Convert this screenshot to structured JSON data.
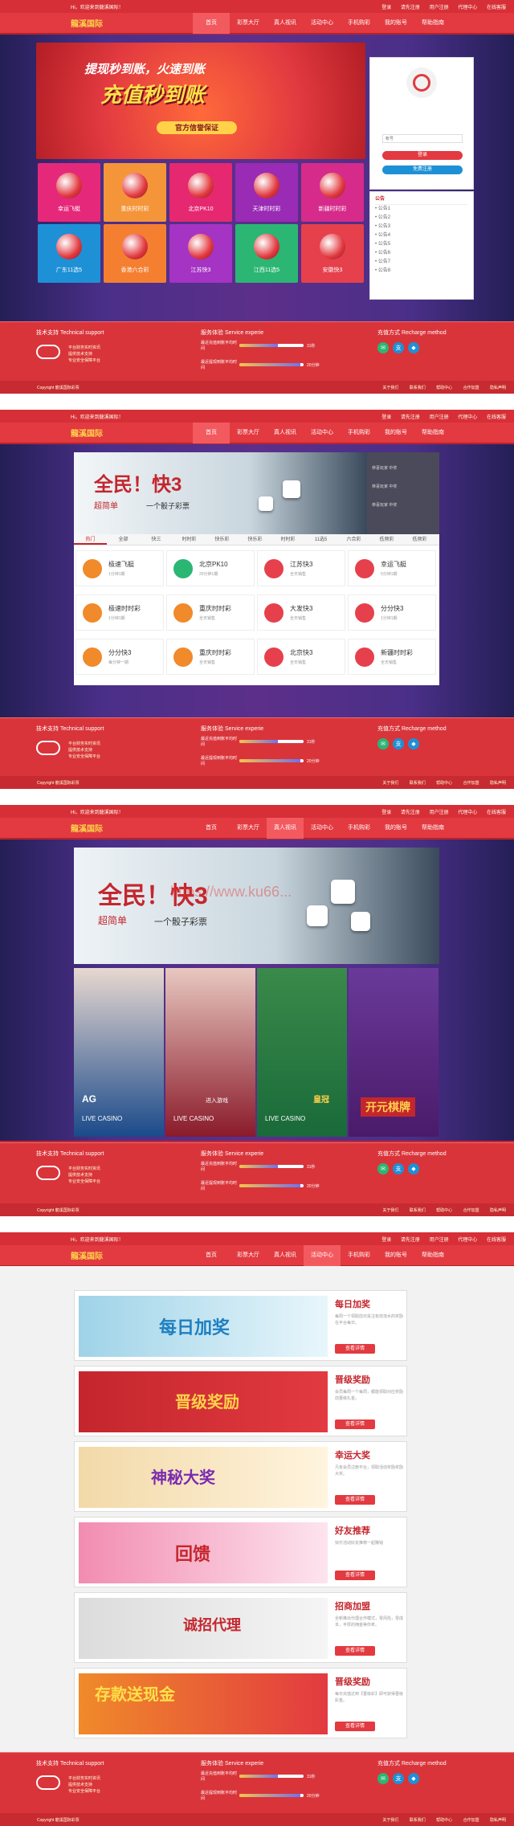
{
  "site": {
    "logo": "龍溪国际",
    "top_left": "Hi，欢迎来到龍溪国际！",
    "top_links": [
      "登录",
      "请先注册",
      "用户注册",
      "代理中心",
      "在线客服"
    ]
  },
  "nav": {
    "items": [
      "首页",
      "彩票大厅",
      "真人视讯",
      "活动中心",
      "手机购彩",
      "我的账号",
      "帮助指南"
    ],
    "active_per_screen": [
      0,
      0,
      2,
      3
    ]
  },
  "screen1": {
    "hero_line1": "提现秒到账，火速到账",
    "hero_line2": "充值秒到账",
    "hero_btn": "官方信誉保证",
    "login": {
      "username_placeholder": "帐号",
      "login_btn": "登录",
      "register_btn": "免费注册"
    },
    "notice_title": "公告",
    "notice_items": [
      "• 公告1",
      "• 公告2",
      "• 公告3",
      "• 公告4",
      "• 公告5",
      "• 公告6",
      "• 公告7",
      "• 公告8"
    ],
    "tiles": [
      {
        "name": "幸运飞艇",
        "color": "#e6287a"
      },
      {
        "name": "重庆时时彩",
        "color": "#f5953a"
      },
      {
        "name": "北京PK10",
        "color": "#e62870"
      },
      {
        "name": "天津时时彩",
        "color": "#9a2bb5"
      },
      {
        "name": "新疆时时彩",
        "color": "#d62b8a"
      },
      {
        "name": "广东11选5",
        "color": "#1e90d6"
      },
      {
        "name": "香港六合彩",
        "color": "#f57f31"
      },
      {
        "name": "江苏快3",
        "color": "#a533c3"
      },
      {
        "name": "江西11选5",
        "color": "#2cb673"
      },
      {
        "name": "安徽快3",
        "color": "#e6404c"
      }
    ]
  },
  "screen2": {
    "banner_title": "全民！快3",
    "banner_sub": "超简单",
    "banner_sub2": "一个骰子彩票",
    "side_users": [
      "恭喜玩家 中奖",
      "恭喜玩家 中奖",
      "恭喜玩家 中奖"
    ],
    "tabs": [
      "热门",
      "全部",
      "快三",
      "时时彩",
      "快乐彩",
      "快乐彩",
      "时时彩",
      "11选5",
      "六合彩",
      "低频彩",
      "低频彩"
    ],
    "cards": [
      {
        "name": "极速飞艇",
        "sub": "1分钟1期",
        "color": "#f08a2a"
      },
      {
        "name": "北京PK10",
        "sub": "20分钟1期",
        "color": "#2bb673"
      },
      {
        "name": "江苏快3",
        "sub": "全天销售",
        "color": "#e6404c"
      },
      {
        "name": "幸运飞艇",
        "sub": "5分钟1期",
        "color": "#e6404c"
      },
      {
        "name": "极速时时彩",
        "sub": "1分钟1期",
        "color": "#f08a2a"
      },
      {
        "name": "重庆时时彩",
        "sub": "全天销售",
        "color": "#f08a2a"
      },
      {
        "name": "大发快3",
        "sub": "全天销售",
        "color": "#e6404c"
      },
      {
        "name": "分分快3",
        "sub": "1分钟1期",
        "color": "#e6404c"
      },
      {
        "name": "分分快3",
        "sub": "每分钟一期",
        "color": "#f08a2a"
      },
      {
        "name": "重庆时时彩",
        "sub": "全天销售",
        "color": "#f08a2a"
      },
      {
        "name": "北京快3",
        "sub": "全天销售",
        "color": "#e6404c"
      },
      {
        "name": "新疆时时彩",
        "sub": "全天销售",
        "color": "#e6404c"
      }
    ]
  },
  "screen3": {
    "banner_title": "全民！快3",
    "banner_sub": "超简单",
    "banner_sub2": "一个骰子彩票",
    "watermark": "https://www.ku66...",
    "casinos": [
      {
        "label": "LIVE CASINO",
        "brand": "AG",
        "color": "#1a4a8a"
      },
      {
        "label": "LIVE CASINO",
        "brand": "进入游戏",
        "color": "#8a1a2a"
      },
      {
        "label": "LIVE CASINO",
        "brand": "皇冠",
        "color": "#1a6a3a"
      },
      {
        "label": "开元棋牌",
        "brand": "",
        "color": "#4a1a6a"
      }
    ]
  },
  "screen4": {
    "promos": [
      {
        "title": "每日加奖",
        "banner": "每日加奖",
        "desc": "每周一个领取前日投注有效流水的奖励在平台每日。",
        "btn": "查看详情",
        "bg1": "#9fd3e8",
        "bg2": "#e8f6fb"
      },
      {
        "title": "晋级奖励",
        "banner": "晋级奖励",
        "desc": "会员每周一个每周，都能领取对应奖励前晋级礼金。",
        "btn": "查看详情",
        "bg1": "#c4262d",
        "bg2": "#e23a40"
      },
      {
        "title": "幸运大奖",
        "banner": "神秘大奖",
        "desc": "凡有会员注册平台，领取活动奖励奖励大奖。",
        "btn": "查看详情",
        "bg1": "#f2d9a8",
        "bg2": "#fff4de"
      },
      {
        "title": "好友推荐",
        "banner": "回馈",
        "desc": "快乐活动好友推荐一起赚钱",
        "btn": "查看详情",
        "bg1": "#f28cb0",
        "bg2": "#fde4ee"
      },
      {
        "title": "招商加盟",
        "banner": "诚招代理",
        "desc": "全新推出代理合作模式，零风险，零成本，丰厚的佣金等你拿。",
        "btn": "查看详情",
        "bg1": "#dcdcdc",
        "bg2": "#f5f5f5"
      },
      {
        "title": "晋级奖励",
        "banner": "存款送现金",
        "desc": "每日充值达到【晋级彩】即可获得晋级彩金。",
        "btn": "查看详情",
        "bg1": "#f08a2a",
        "bg2": "#e23a40"
      }
    ]
  },
  "footer": {
    "support_title": "技术支持 Technical support",
    "service_title": "服务体验 Service experie",
    "recharge_title": "充值方式 Recharge method",
    "support_lines": [
      "平台财务实时资讯",
      "提供技术支持",
      "专业安全保障平台"
    ],
    "bar1_label": "最近充值到账平均时间",
    "bar1_value": "31秒",
    "bar1_fill": 0.6,
    "bar2_label": "最近提现到账平均时间",
    "bar2_value": "20分钟",
    "bar2_fill": 0.95,
    "pay_icons": [
      {
        "name": "wechat-icon",
        "glyph": "✉",
        "color": "#2bb673"
      },
      {
        "name": "alipay-icon",
        "glyph": "支",
        "color": "#1e90d6"
      },
      {
        "name": "bank-icon",
        "glyph": "◆",
        "color": "#1e90d6"
      }
    ],
    "copyright": "Copyright 龍溪国际彩票",
    "bottom_links": [
      "关于我们",
      "联系我们",
      "帮助中心",
      "合作加盟",
      "隐私声明"
    ]
  }
}
